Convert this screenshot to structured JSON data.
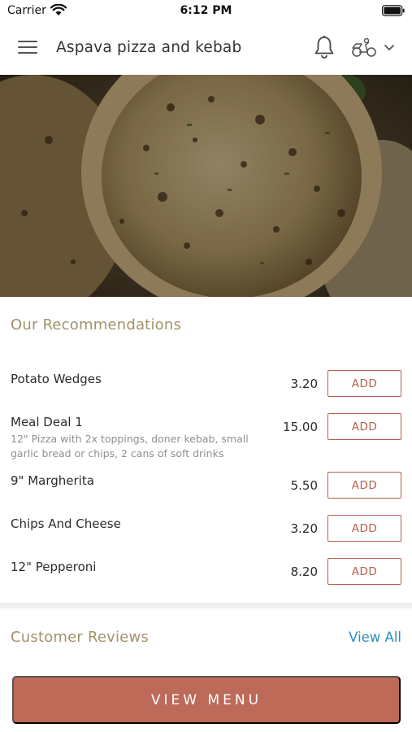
{
  "status_bar": {
    "carrier": "Carrier",
    "time": "6:12 PM"
  },
  "header": {
    "title": "Aspava pizza and kebab"
  },
  "recommendations": {
    "title": "Our Recommendations",
    "add_label": "ADD",
    "items": [
      {
        "name": "Potato Wedges",
        "description": "",
        "price": "3.20"
      },
      {
        "name": "Meal Deal 1",
        "description": "12\" Pizza with 2x toppings, doner kebab, small garlic bread or chips, 2 cans of soft drinks",
        "price": "15.00"
      },
      {
        "name": "9\" Margherita",
        "description": "",
        "price": "5.50"
      },
      {
        "name": "Chips And Cheese",
        "description": "",
        "price": "3.20"
      },
      {
        "name": "12\" Pepperoni",
        "description": "",
        "price": "8.20"
      }
    ]
  },
  "reviews": {
    "title": "Customer Reviews",
    "view_all": "View All"
  },
  "footer": {
    "view_menu": "VIEW MENU"
  },
  "colors": {
    "accent": "#bd6a58",
    "section_title": "#a2926b",
    "link": "#2c8dc1"
  }
}
